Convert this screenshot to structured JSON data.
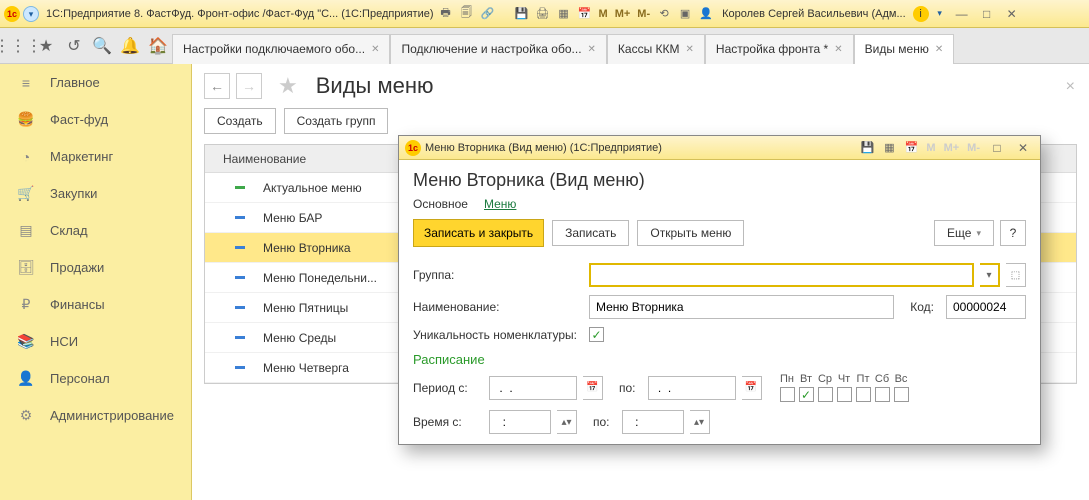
{
  "titlebar": {
    "appTitle": "1С:Предприятие 8. ФастФуд. Фронт-офис /Фаст-Фуд \"С...  (1С:Предприятие)",
    "userName": "Королев Сергей Васильевич (Адм..."
  },
  "tabs": [
    {
      "label": "Настройки подключаемого обо..."
    },
    {
      "label": "Подключение и настройка обо..."
    },
    {
      "label": "Кассы ККМ"
    },
    {
      "label": "Настройка фронта *"
    },
    {
      "label": "Виды меню",
      "active": true
    }
  ],
  "sidebar": {
    "items": [
      {
        "icon": "menu",
        "label": "Главное"
      },
      {
        "icon": "burger",
        "label": "Фаст-фуд"
      },
      {
        "icon": "pie",
        "label": "Маркетинг"
      },
      {
        "icon": "cart",
        "label": "Закупки"
      },
      {
        "icon": "stock",
        "label": "Склад"
      },
      {
        "icon": "sales",
        "label": "Продажи"
      },
      {
        "icon": "fin",
        "label": "Финансы"
      },
      {
        "icon": "nsi",
        "label": "НСИ"
      },
      {
        "icon": "person",
        "label": "Персонал"
      },
      {
        "icon": "gear",
        "label": "Администрирование"
      }
    ]
  },
  "page": {
    "title": "Виды меню",
    "createBtn": "Создать",
    "createGroupBtn": "Создать групп",
    "colHeader": "Наименование",
    "rows": [
      {
        "label": "Актуальное меню",
        "marker": "green"
      },
      {
        "label": "Меню БАР",
        "marker": "blue"
      },
      {
        "label": "Меню Вторника",
        "marker": "blue",
        "selected": true
      },
      {
        "label": "Меню Понедельни...",
        "marker": "blue"
      },
      {
        "label": "Меню Пятницы",
        "marker": "blue"
      },
      {
        "label": "Меню Среды",
        "marker": "blue"
      },
      {
        "label": "Меню Четверга",
        "marker": "blue"
      }
    ]
  },
  "modal": {
    "windowTitle": "Меню Вторника (Вид меню)  (1С:Предприятие)",
    "heading": "Меню Вторника (Вид меню)",
    "tabMain": "Основное",
    "tabMenu": "Меню",
    "saveClose": "Записать и закрыть",
    "save": "Записать",
    "openMenu": "Открыть меню",
    "more": "Еще",
    "groupLbl": "Группа:",
    "groupVal": "",
    "nameLbl": "Наименование:",
    "nameVal": "Меню Вторника",
    "codeLbl": "Код:",
    "codeVal": "00000024",
    "uniqueLbl": "Уникальность номенклатуры:",
    "uniqueChecked": true,
    "scheduleTitle": "Расписание",
    "periodFromLbl": "Период с:",
    "periodToLbl": "по:",
    "dateMask": " .  .    ",
    "timeFromLbl": "Время с:",
    "timeToLbl": "по:",
    "timeMask": "  :  ",
    "days": [
      "Пн",
      "Вт",
      "Ср",
      "Чт",
      "Пт",
      "Сб",
      "Вс"
    ],
    "daysChecked": [
      false,
      true,
      false,
      false,
      false,
      false,
      false
    ]
  }
}
